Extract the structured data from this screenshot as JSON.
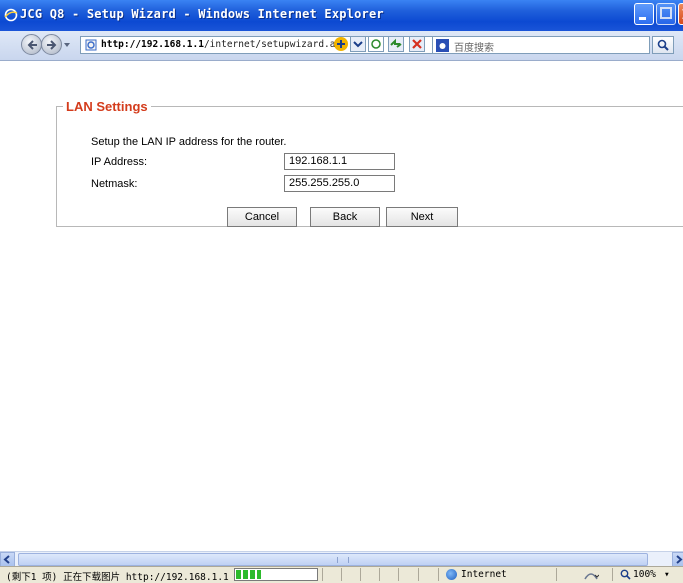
{
  "window": {
    "title": "JCG Q8 - Setup Wizard - Windows Internet Explorer"
  },
  "address_bar": {
    "url_host": "http://192.168.1.1",
    "url_path": "/internet/setupwizard.asp"
  },
  "search": {
    "placeholder": "百度搜索"
  },
  "form": {
    "legend": "LAN Settings",
    "description": "Setup the LAN IP address for the router.",
    "fields": [
      {
        "label": "IP Address:",
        "value": "192.168.1.1"
      },
      {
        "label": "Netmask:",
        "value": "255.255.255.0"
      }
    ],
    "buttons": {
      "cancel": "Cancel",
      "back": "Back",
      "next": "Next"
    }
  },
  "status_bar": {
    "text": "(剩下1 项) 正在下载图片 http://192.168.1.1",
    "progress_percent": 30,
    "zone": "Internet",
    "zoom": "100%"
  },
  "colors": {
    "title_bar": "#0c49d2",
    "legend": "#d43c1c",
    "progress": "#2cba2c"
  },
  "icons": [
    "ie-icon",
    "minimize-icon",
    "maximize-icon",
    "close-icon",
    "back-arrow-icon",
    "forward-arrow-icon",
    "page-icon",
    "compat-icon",
    "dropdown-icon",
    "rss-icon",
    "refresh-icon",
    "stop-icon",
    "baidu-icon",
    "search-icon",
    "globe-icon",
    "security-icon",
    "zoom-icon"
  ]
}
